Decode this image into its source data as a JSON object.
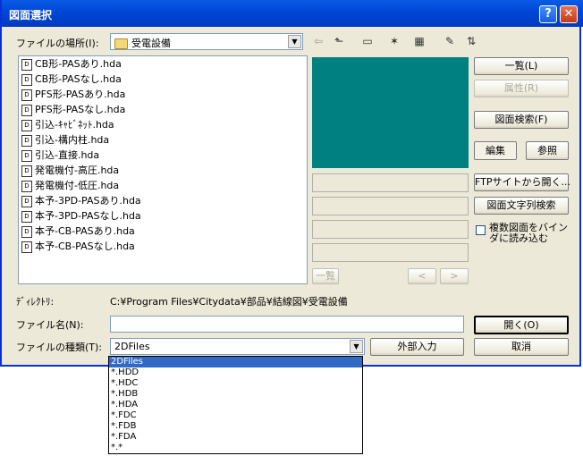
{
  "window": {
    "title": "図面選択",
    "help_glyph": "?",
    "close_glyph": "✕"
  },
  "toolbar": {
    "location_label": "ファイルの場所(I):",
    "location_value": "受電設備",
    "icons": [
      "back-arrow-icon",
      "up-folder-icon",
      "new-folder-icon",
      "view-menu-icon",
      "tools-icon",
      "sort-icon"
    ]
  },
  "files": [
    "CB形-PASあり.hda",
    "CB形-PASなし.hda",
    "PFS形-PASあり.hda",
    "PFS形-PASなし.hda",
    "引込-ｷｬﾋﾞﾈｯﾄ.hda",
    "引込-構内柱.hda",
    "引込-直接.hda",
    "発電機付-高圧.hda",
    "発電機付-低圧.hda",
    "本予-3PD-PASあり.hda",
    "本予-3PD-PASなし.hda",
    "本予-CB-PASあり.hda",
    "本予-CB-PASなし.hda"
  ],
  "right_buttons": {
    "list": "一覧(L)",
    "props": "属性(R)",
    "search": "図面検索(F)",
    "edit": "編集",
    "ref": "参照",
    "ftp": "FTPサイトから開く...",
    "textsearch": "図面文字列検索",
    "binary_check": "複数図面をバインダに読み込む"
  },
  "preview_nav": {
    "list": "一覧",
    "prev": "<",
    "next": ">"
  },
  "directory": {
    "label": "ﾃﾞｨﾚｸﾄﾘ:",
    "path": "C:¥Program Files¥Citydata¥部品¥結線図¥受電設備"
  },
  "filename": {
    "label": "ファイル名(N):",
    "value": ""
  },
  "filetype": {
    "label": "ファイルの種類(T):",
    "value": "2DFiles",
    "options": [
      "2DFiles",
      "*.HDD",
      "*.HDC",
      "*.HDB",
      "*.HDA",
      "*.FDC",
      "*.FDB",
      "*.FDA",
      "*.*"
    ]
  },
  "bottom_buttons": {
    "external": "外部入力",
    "open": "開く(O)",
    "cancel": "取消"
  }
}
